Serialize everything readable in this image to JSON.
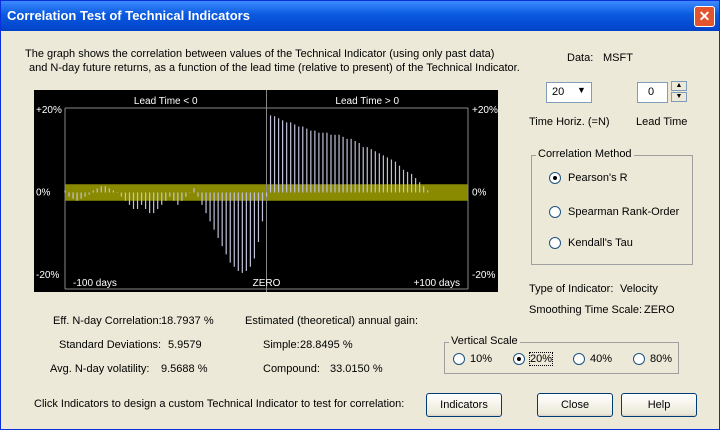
{
  "window": {
    "title": "Correlation Test of Technical Indicators",
    "close_glyph": "✕"
  },
  "description": {
    "line1": "The graph shows the correlation between values of the Technical Indicator (using only past data)",
    "line2": "and N-day future returns, as a function of the lead time (relative to present) of the Technical Indicator."
  },
  "data_info": {
    "label": "Data:",
    "value": "MSFT"
  },
  "time_horiz": {
    "value": "20",
    "label": "Time Horiz. (=N)"
  },
  "lead_time": {
    "value": "0",
    "label": "Lead Time"
  },
  "correlation_method": {
    "legend": "Correlation Method",
    "options": [
      "Pearson's R",
      "Spearman Rank-Order",
      "Kendall's Tau"
    ],
    "selected": 0
  },
  "indicator": {
    "type_label": "Type of Indicator:",
    "type_value": "Velocity",
    "smoothing_label": "Smoothing Time Scale:",
    "smoothing_value": "ZERO"
  },
  "stats": {
    "eff_label": "Eff. N-day Correlation:",
    "eff_value": "18.7937 %",
    "std_label": "Standard Deviations:",
    "std_value": "5.9579",
    "vol_label": "Avg. N-day volatility:",
    "vol_value": "9.5688 %",
    "gain_header": "Estimated (theoretical) annual gain:",
    "simple_label": "Simple:",
    "simple_value": "28.8495 %",
    "compound_label": "Compound:",
    "compound_value": "33.0150 %"
  },
  "vertical_scale": {
    "legend": "Vertical Scale",
    "options": [
      "10%",
      "20%",
      "40%",
      "80%"
    ],
    "selected": 1
  },
  "footer": {
    "hint": "Click Indicators to design a custom Technical Indicator to test for correlation:",
    "indicators_label": "Indicators",
    "close_label": "Close",
    "help_label": "Help"
  },
  "colors": {
    "plot_bg": "#000000",
    "band": "#8a8a00",
    "bar": "#c0c0d8",
    "text": "#ffffff"
  },
  "chart_data": {
    "type": "bar",
    "top_labels": [
      "Lead Time < 0",
      "Lead Time > 0"
    ],
    "y_tick_labels": [
      "+20%",
      "0%",
      "-20%"
    ],
    "x_tick_labels": [
      "-100 days",
      "ZERO",
      "+100 days"
    ],
    "x_range": [
      -100,
      100
    ],
    "ylim": [
      -20,
      20
    ],
    "significance_band": [
      -2,
      2
    ],
    "x": [
      -100,
      -98,
      -96,
      -94,
      -92,
      -90,
      -88,
      -86,
      -84,
      -82,
      -80,
      -78,
      -76,
      -74,
      -72,
      -70,
      -68,
      -66,
      -64,
      -62,
      -60,
      -58,
      -56,
      -54,
      -52,
      -50,
      -48,
      -46,
      -44,
      -42,
      -40,
      -38,
      -36,
      -34,
      -32,
      -30,
      -28,
      -26,
      -24,
      -22,
      -20,
      -18,
      -16,
      -14,
      -12,
      -10,
      -8,
      -6,
      -4,
      -2,
      0,
      2,
      4,
      6,
      8,
      10,
      12,
      14,
      16,
      18,
      20,
      22,
      24,
      26,
      28,
      30,
      32,
      34,
      36,
      38,
      40,
      42,
      44,
      46,
      48,
      50,
      52,
      54,
      56,
      58,
      60,
      62,
      64,
      66,
      68,
      70,
      72,
      74,
      76,
      78,
      80
    ],
    "values": [
      0.5,
      -1,
      -1.5,
      -2,
      -1.5,
      -1,
      -0.5,
      0.5,
      1,
      1.5,
      1.5,
      1,
      0.5,
      0,
      -1,
      -2,
      -3,
      -4,
      -4,
      -3,
      -4,
      -5,
      -5,
      -4,
      -3,
      -2,
      -1,
      -2,
      -3,
      -2,
      -1,
      0,
      1,
      -1,
      -3,
      -5,
      -7,
      -9,
      -11,
      -13,
      -15,
      -17,
      -18,
      -19,
      -19.5,
      -19,
      -18,
      -16,
      -12,
      -7,
      -1,
      18.7,
      18.5,
      18,
      17.5,
      17,
      17,
      16.5,
      16,
      16,
      15.5,
      15,
      15,
      14.5,
      14.5,
      14.5,
      14,
      14,
      14,
      13.5,
      13,
      13,
      12.5,
      12,
      11,
      11,
      10.5,
      10,
      9.5,
      9,
      8.5,
      8,
      7.5,
      6.5,
      5.5,
      5,
      4.5,
      3.5,
      2.5,
      1.5,
      0.5
    ]
  }
}
